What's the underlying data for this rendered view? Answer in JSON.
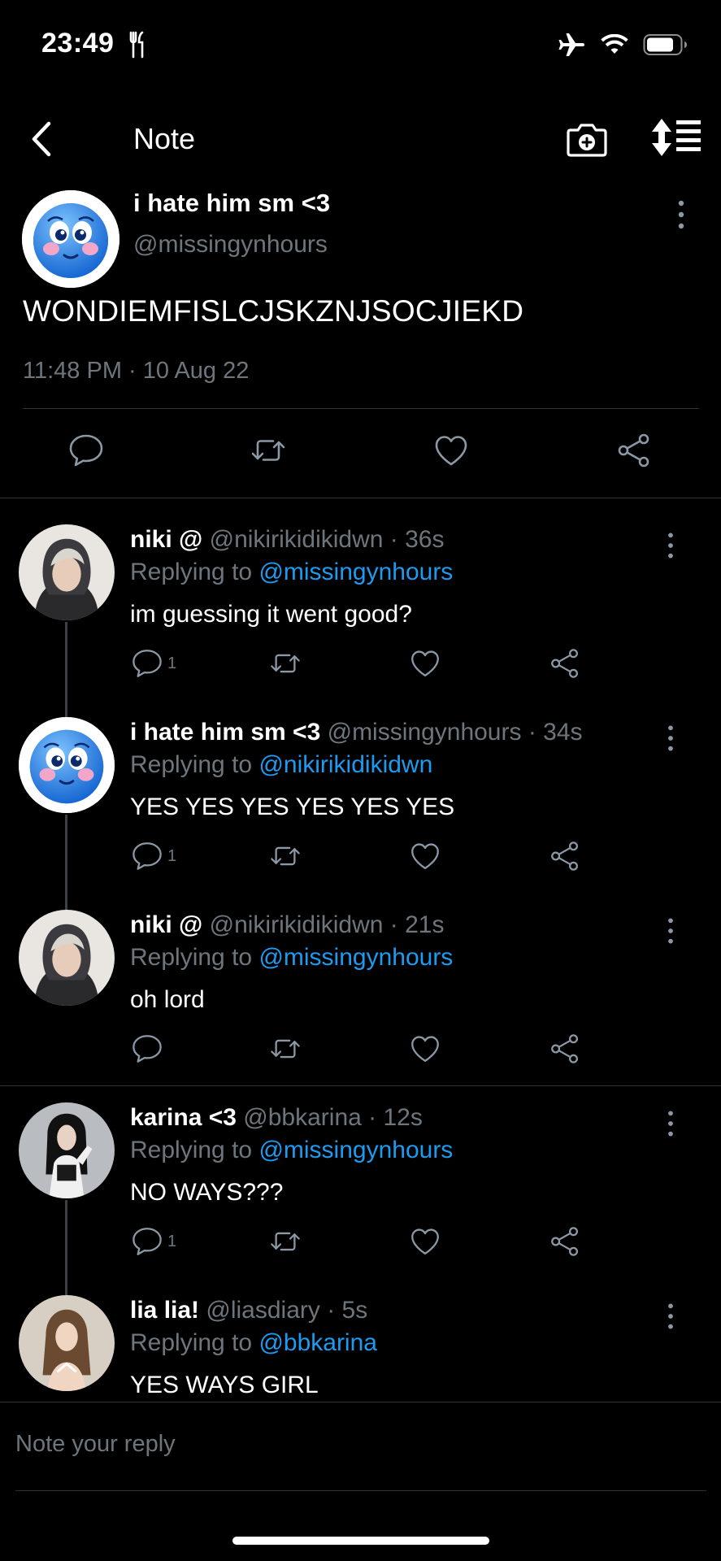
{
  "status_bar": {
    "time": "23:49",
    "icons": [
      "fork-knife-icon",
      "airplane-icon",
      "wifi-icon",
      "battery-icon"
    ]
  },
  "nav": {
    "title": "Note",
    "icons": [
      "back-chevron-icon",
      "camera-plus-icon",
      "sort-icon"
    ]
  },
  "main_post": {
    "display_name": "i hate him sm <3",
    "handle": "@missingynhours",
    "text": "WONDIEMFISLCJSKZNJSOCJIEKD",
    "timestamp": "11:48 PM · 10 Aug 22",
    "actions": [
      "reply-icon",
      "retweet-icon",
      "like-icon",
      "share-icon"
    ]
  },
  "replies": [
    {
      "name": "niki @",
      "meta": "@nikirikidikidwn · 36s",
      "replying_label": "Replying to",
      "replying_to": "@missingynhours",
      "text": "im guessing it went good?",
      "reply_count": "1",
      "avatar": "niki-avatar"
    },
    {
      "name": "i hate him sm <3",
      "meta": "@missingynhours · 34s",
      "replying_label": "Replying to",
      "replying_to": "@nikirikidikidwn",
      "text": "YES YES YES YES YES YES",
      "reply_count": "1",
      "avatar": "blue-face-avatar"
    },
    {
      "name": "niki @",
      "meta": "@nikirikidikidwn · 21s",
      "replying_label": "Replying to",
      "replying_to": "@missingynhours",
      "text": "oh lord",
      "reply_count": "",
      "avatar": "niki-avatar"
    },
    {
      "name": "karina <3",
      "meta": "@bbkarina · 12s",
      "replying_label": "Replying to",
      "replying_to": "@missingynhours",
      "text": "NO WAYS???",
      "reply_count": "1",
      "avatar": "karina-avatar"
    },
    {
      "name": "lia lia!",
      "meta": "@liasdiary · 5s",
      "replying_label": "Replying to",
      "replying_to": "@bbkarina",
      "text": "YES WAYS GIRL",
      "reply_count": "",
      "avatar": "lia-avatar"
    }
  ],
  "composer": {
    "placeholder": "Note your reply"
  },
  "colors": {
    "background": "#000000",
    "text": "#ffffff",
    "muted": "#6e767d",
    "link": "#1d9bf0",
    "divider": "#2f3336"
  }
}
